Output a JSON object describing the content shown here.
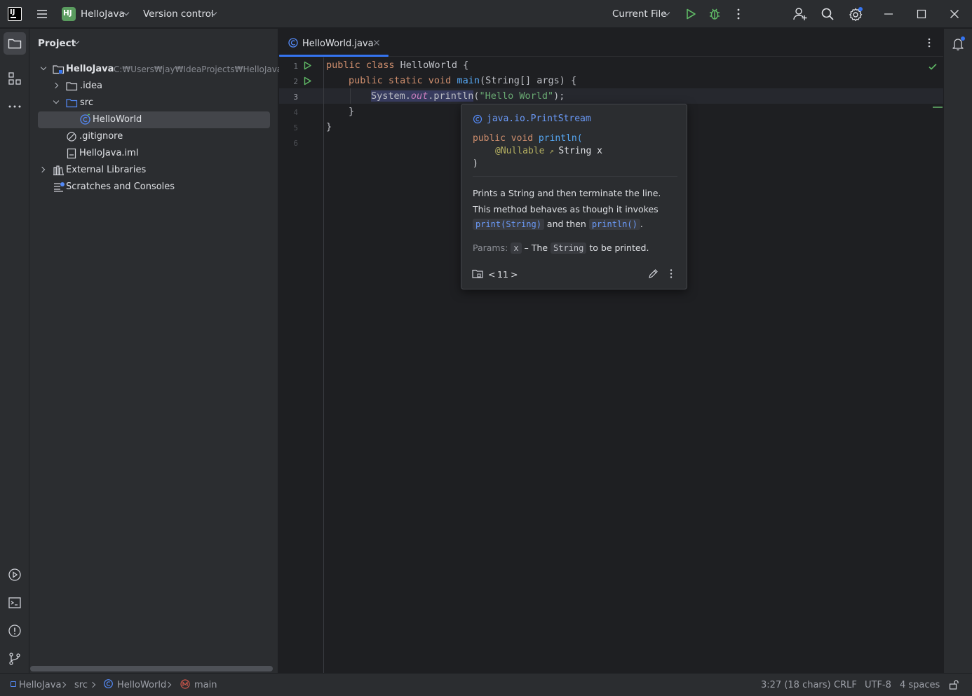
{
  "titlebar": {
    "app_logo": "IJ",
    "project_badge": "HJ",
    "project_name": "HelloJava",
    "vcs_label": "Version control",
    "run_config": "Current File"
  },
  "project_panel": {
    "title": "Project",
    "root": {
      "name": "HelloJava",
      "path": "C:₩Users₩jay₩IdeaProjects₩HelloJava"
    },
    "items": [
      {
        "label": ".idea"
      },
      {
        "label": "src"
      },
      {
        "label": "HelloWorld"
      },
      {
        "label": ".gitignore"
      },
      {
        "label": "HelloJava.iml"
      },
      {
        "label": "External Libraries"
      },
      {
        "label": "Scratches and Consoles"
      }
    ]
  },
  "editor": {
    "tab_label": "HelloWorld.java",
    "line_numbers": [
      "1",
      "2",
      "3",
      "4",
      "5",
      "6"
    ],
    "code": {
      "l1_kw": "public class",
      "l1_rest": " HelloWorld {",
      "l2_kw": "public static void",
      "l2_fn": "main",
      "l2_rest": "(String[] args) {",
      "l3_a": "System.",
      "l3_field": "out",
      "l3_b": ".println",
      "l3_paren": "(",
      "l3_str": "\"Hello World\"",
      "l3_end": ");",
      "l4": "}",
      "l5": "}"
    }
  },
  "doc_popup": {
    "class_name": "java.io.PrintStream",
    "sig_kw": "public void",
    "sig_fn": "println(",
    "sig_annotation": "@Nullable",
    "sig_param": "String x",
    "sig_close": ")",
    "desc_line1": "Prints a String and then terminate the line.",
    "desc_line2": "This method behaves as though it invokes",
    "chip_print": "print(String)",
    "and_then": "and then",
    "chip_println": "println()",
    "period": ".",
    "params_label": "Params:",
    "param_name": "x",
    "param_dash": "– The",
    "param_type": "String",
    "param_rest": "to be printed.",
    "nav_prev": "<",
    "nav_count": "11",
    "nav_next": ">"
  },
  "statusbar": {
    "breadcrumbs": [
      "HelloJava",
      "src",
      "HelloWorld",
      "main"
    ],
    "position": "3:27 (18 chars)",
    "line_sep": "CRLF",
    "encoding": "UTF-8",
    "indent": "4 spaces"
  },
  "colors": {
    "accent": "#3574f0",
    "run_green": "#5fb865",
    "keyword": "#cf8e6d",
    "function": "#56a8f5",
    "string": "#6aab73"
  }
}
